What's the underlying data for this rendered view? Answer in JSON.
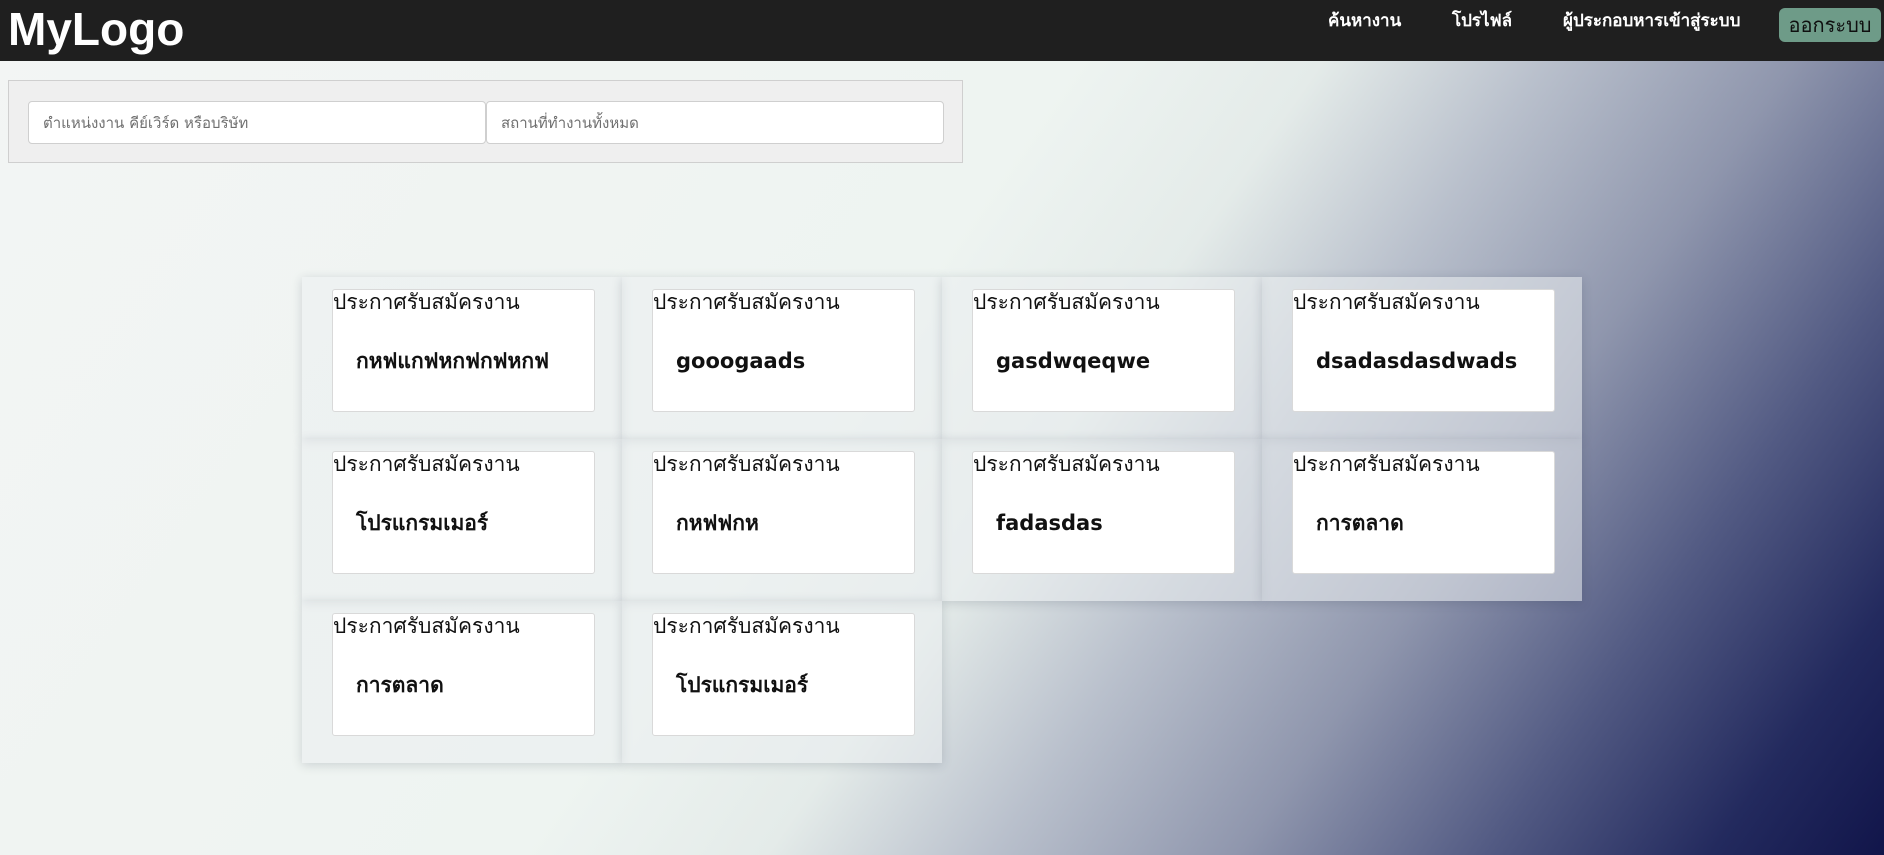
{
  "header": {
    "logo": "MyLogo",
    "nav": {
      "search_jobs": "ค้นหางาน",
      "profile": "โปรไฟล์",
      "employer_login": "ผู้ประกอบหารเข้าสู่ระบบ",
      "logout": "ออกระบบ"
    }
  },
  "search": {
    "job_placeholder": "ตำแหน่งงาน คีย์เวิร์ด หรือบริษัท",
    "location_placeholder": "สถานที่ทำงานทั้งหมด"
  },
  "jobs": [
    {
      "label": "ประกาศรับสมัครงาน",
      "title": "กหฟแกฟหกฟกฟหกฟ"
    },
    {
      "label": "ประกาศรับสมัครงาน",
      "title": "gooogaads"
    },
    {
      "label": "ประกาศรับสมัครงาน",
      "title": "gasdwqeqwe"
    },
    {
      "label": "ประกาศรับสมัครงาน",
      "title": "dsadasdasdwads"
    },
    {
      "label": "ประกาศรับสมัครงาน",
      "title": "โปรแกรมเมอร์"
    },
    {
      "label": "ประกาศรับสมัครงาน",
      "title": "กหฟฟกห"
    },
    {
      "label": "ประกาศรับสมัครงาน",
      "title": "fadasdas"
    },
    {
      "label": "ประกาศรับสมัครงาน",
      "title": "การตลาด"
    },
    {
      "label": "ประกาศรับสมัครงาน",
      "title": "การตลาด"
    },
    {
      "label": "ประกาศรับสมัครงาน",
      "title": "โปรแกรมเมอร์"
    }
  ]
}
